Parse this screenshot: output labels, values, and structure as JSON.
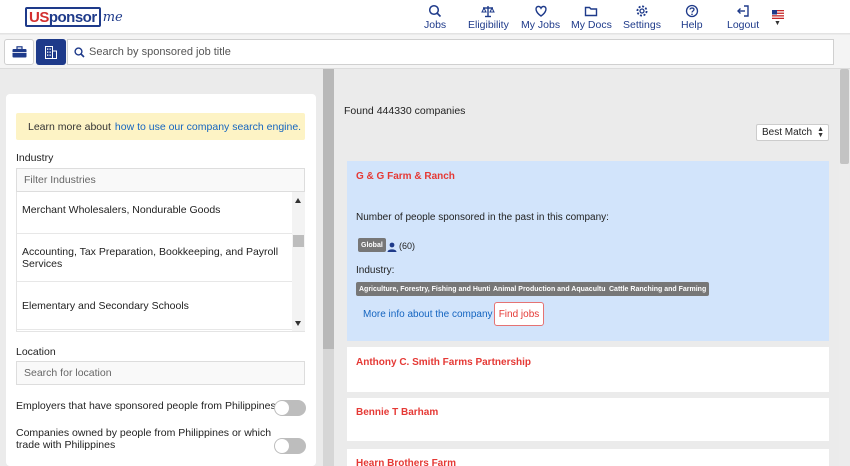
{
  "brand": {
    "part1": "US",
    "part2": "ponsor",
    "part3": "me"
  },
  "nav": {
    "items": [
      {
        "label": "Jobs",
        "icon": "search-icon"
      },
      {
        "label": "Eligibility",
        "icon": "scale-icon"
      },
      {
        "label": "My Jobs",
        "icon": "heart-icon"
      },
      {
        "label": "My Docs",
        "icon": "folder-icon"
      },
      {
        "label": "Settings",
        "icon": "gear-icon"
      },
      {
        "label": "Help",
        "icon": "help-icon"
      },
      {
        "label": "Logout",
        "icon": "logout-icon"
      }
    ],
    "flag": "us-flag-icon"
  },
  "search": {
    "placeholder": "Search by sponsored job title"
  },
  "filters": {
    "banner_text": "Learn more about",
    "banner_link": "how to use our company search engine.",
    "industry_label": "Industry",
    "industry_placeholder": "Filter Industries",
    "industries": [
      "Merchant Wholesalers, Nondurable Goods",
      "Accounting, Tax Preparation, Bookkeeping, and Payroll Services",
      "Elementary and Secondary Schools"
    ],
    "location_label": "Location",
    "location_placeholder": "Search for location",
    "toggle1": "Employers that have sponsored people from Philippines",
    "toggle2": "Companies owned by people from Philippines or which trade with Philippines"
  },
  "results": {
    "found_text": "Found 444330 companies",
    "sort_value": "Best Match",
    "companies": [
      {
        "name": "G & G Farm & Ranch",
        "sponsored_text": "Number of people sponsored in the past in this company:",
        "badge": "Global",
        "count": "(60)",
        "industry_label": "Industry:",
        "industry_tags": [
          "Agriculture, Forestry, Fishing and Hunting",
          "Animal Production and Aquaculture",
          "Cattle Ranching and Farming"
        ],
        "more_info": "More info about the company",
        "find_jobs": "Find jobs"
      },
      {
        "name": "Anthony C. Smith Farms Partnership"
      },
      {
        "name": "Bennie T Barham"
      },
      {
        "name": "Hearn Brothers Farm"
      }
    ]
  },
  "colors": {
    "brand": "#1e3a8a",
    "accent_red": "#e53935",
    "selected_card": "#d2e4fb",
    "banner": "#fdf3c5"
  }
}
